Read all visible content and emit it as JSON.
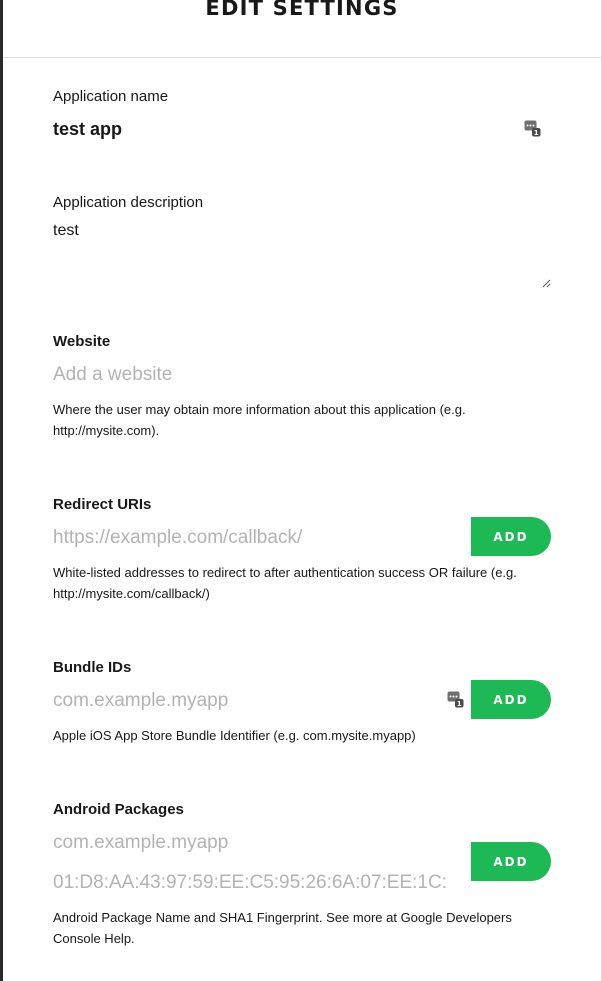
{
  "header": {
    "title": "EDIT SETTINGS"
  },
  "app_name": {
    "label": "Application name",
    "value": "test app",
    "icon": "password-manager-icon"
  },
  "app_description": {
    "label": "Application description",
    "value": "test"
  },
  "website": {
    "label": "Website",
    "placeholder": "Add a website",
    "help": "Where the user may obtain more information about this application (e.g. http://mysite.com)."
  },
  "redirect_uris": {
    "label": "Redirect URIs",
    "placeholder": "https://example.com/callback/",
    "button": "ADD",
    "help": "White-listed addresses to redirect to after authentication success OR failure (e.g. http://mysite.com/callback/)"
  },
  "bundle_ids": {
    "label": "Bundle IDs",
    "placeholder": "com.example.myapp",
    "button": "ADD",
    "icon": "password-manager-icon",
    "help": "Apple iOS App Store Bundle Identifier (e.g. com.mysite.myapp)"
  },
  "android_packages": {
    "label": "Android Packages",
    "package_placeholder": "com.example.myapp",
    "fingerprint_placeholder": "01:D8:AA:43:97:59:EE:C5:95:26:6A:07:EE:1C:",
    "button": "ADD",
    "help": "Android Package Name and SHA1 Fingerprint. See more at Google Developers Console Help."
  },
  "colors": {
    "accent": "#1db954",
    "text": "#181818",
    "placeholder": "#b3b3b3",
    "divider": "#dcdcdc"
  }
}
